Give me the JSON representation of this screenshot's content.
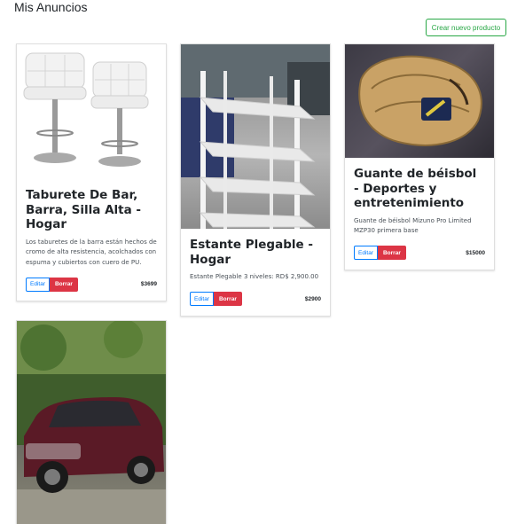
{
  "page": {
    "title": "Mis Anuncios",
    "create_button": "Crear nuevo producto"
  },
  "colors": {
    "create_button": "#28a745",
    "edit_button": "#007bff",
    "delete_button": "#dc3545"
  },
  "listings": [
    {
      "title": "Taburete De Bar, Barra, Silla Alta - Hogar",
      "description": "Los taburetes de la barra están hechos de cromo de alta resistencia, acolchados con espuma y cubiertos con cuero de PU.",
      "price": "$3699",
      "edit_label": "Editar",
      "delete_label": "Borrar",
      "image_icon": "bar-stools-image"
    },
    {
      "title": "Estante Plegable - Hogar",
      "description": "Estante Plegable 3 niveles: RD$ 2,900.00",
      "price": "$2900",
      "edit_label": "Editar",
      "delete_label": "Borrar",
      "image_icon": "folding-shelf-image"
    },
    {
      "title": "Guante de béisbol - Deportes y entretenimiento",
      "description": "Guante de béisbol Mizuno Pro Limited MZP30 primera base",
      "price": "$15000",
      "edit_label": "Editar",
      "delete_label": "Borrar",
      "image_icon": "baseball-glove-image"
    },
    {
      "title": "",
      "description": "",
      "price": "",
      "edit_label": "",
      "delete_label": "",
      "image_icon": "car-image"
    }
  ]
}
